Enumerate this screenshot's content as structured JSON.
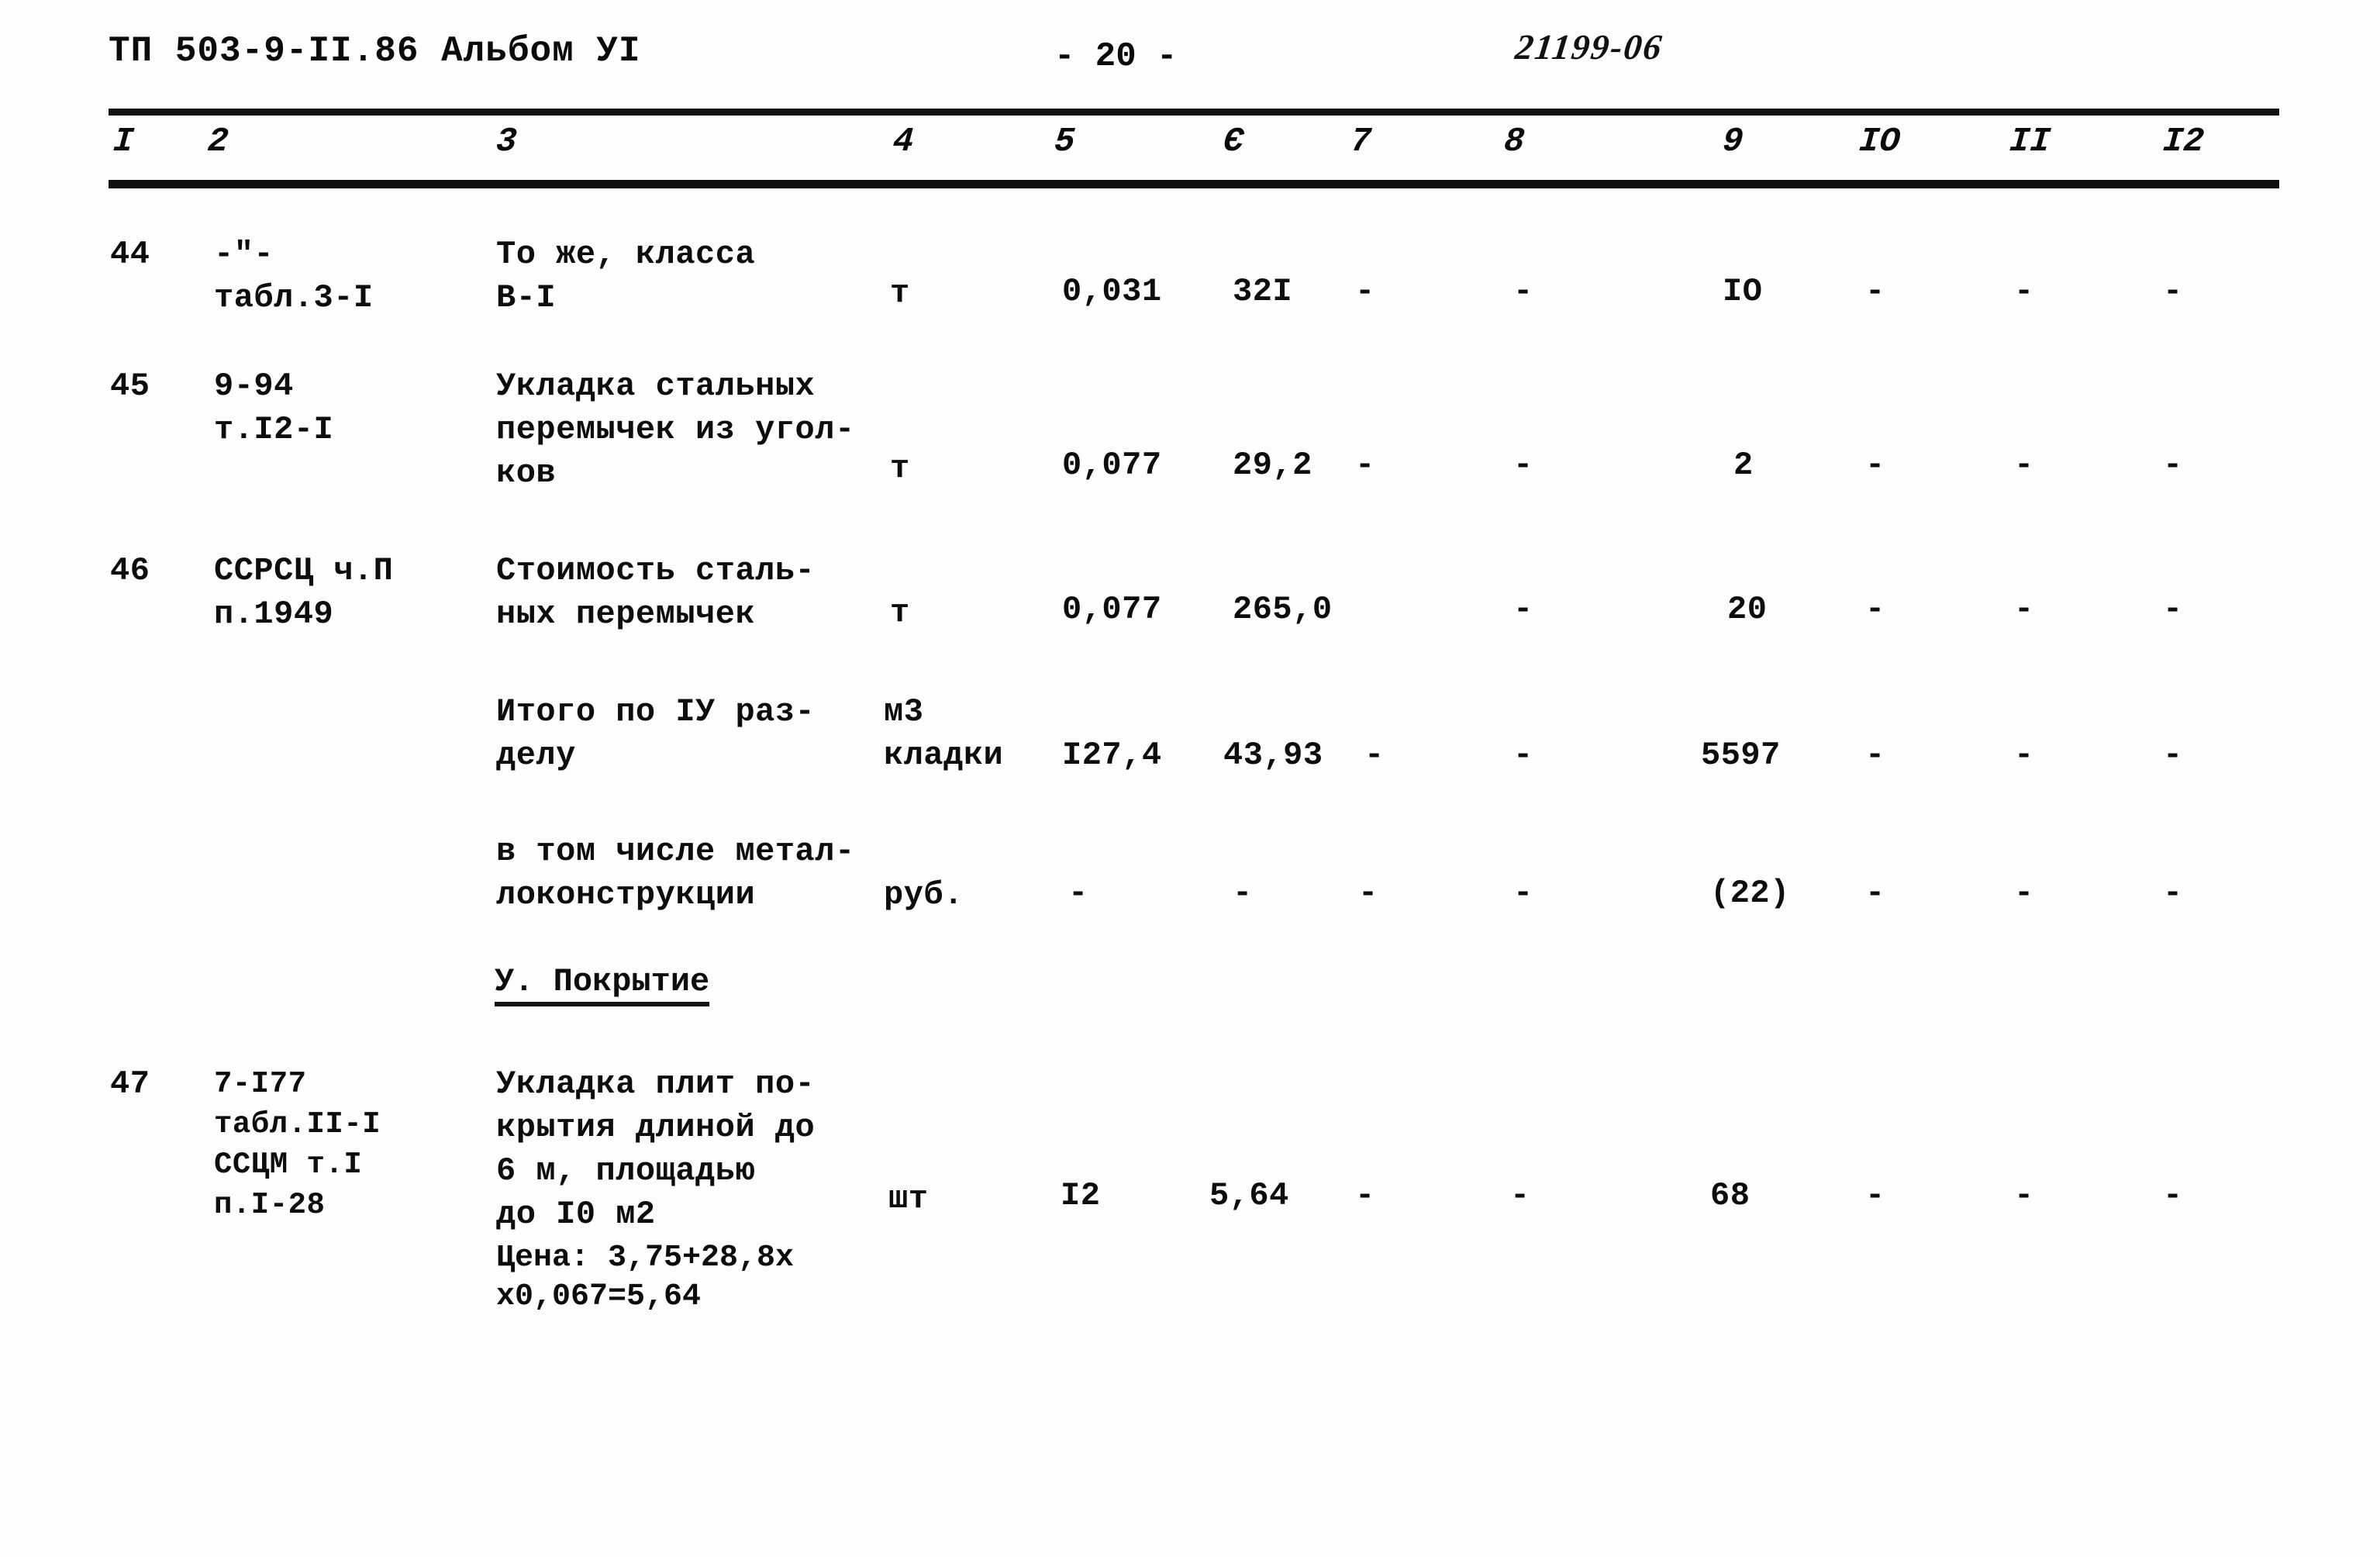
{
  "header": {
    "left_title": "ТП 503-9-II.86 Альбом УI",
    "page_number": "- 20 -",
    "stamp": "21199-06"
  },
  "table": {
    "column_numbers": [
      "I",
      "2",
      "3",
      "4",
      "5",
      "Є",
      "7",
      "8",
      "9",
      "IO",
      "II",
      "I2"
    ],
    "rows": [
      {
        "no": "44",
        "code": "-\"-\nтабл.3-I",
        "description": "То же, класса\nВ-I",
        "unit": "т",
        "c5": "0,031",
        "c6": "32I",
        "c7": "-",
        "c8": "-",
        "c9": "IO",
        "c10": "-",
        "c11": "-",
        "c12": "-"
      },
      {
        "no": "45",
        "code": "9-94\nт.I2-I",
        "description": "Укладка стальных\nперемычек из угол-\nков",
        "unit": "т",
        "c5": "0,077",
        "c6": "29,2",
        "c7": "-",
        "c8": "-",
        "c9": "2",
        "c10": "-",
        "c11": "-",
        "c12": "-"
      },
      {
        "no": "46",
        "code": "ССРСЦ ч.П\nп.1949",
        "description": "Стоимость сталь-\nных перемычек",
        "unit": "т",
        "c5": "0,077",
        "c6": "265,0",
        "c7": "",
        "c8": "-",
        "c9": "20",
        "c10": "-",
        "c11": "-",
        "c12": "-"
      },
      {
        "no": "",
        "code": "",
        "description": "Итого по IУ раз-\nделу",
        "unit": "м3\nкладки",
        "c5": "I27,4",
        "c6": "43,93",
        "c7": "-",
        "c8": "-",
        "c9": "5597",
        "c10": "-",
        "c11": "-",
        "c12": "-"
      },
      {
        "no": "",
        "code": "",
        "description": "в том числе метал-\nлоконструкции",
        "unit": "руб.",
        "c5": "-",
        "c6": "-",
        "c7": "-",
        "c8": "-",
        "c9": "(22)",
        "c10": "-",
        "c11": "-",
        "c12": "-"
      },
      {
        "no": "47",
        "code": "7-I77\nтабл.II-I\nССЦМ т.I\nп.I-28",
        "description": "Укладка плит по-\nкрытия длиной до\n6 м, площадью\nдо I0 м2",
        "unit": "шт",
        "c5": "I2",
        "c6": "5,64",
        "c7": "-",
        "c8": "-",
        "c9": "68",
        "c10": "-",
        "c11": "-",
        "c12": "-"
      }
    ],
    "section_heading": "У. Покрытие",
    "price_note": "Цена: 3,75+28,8х\nх0,067=5,64"
  }
}
